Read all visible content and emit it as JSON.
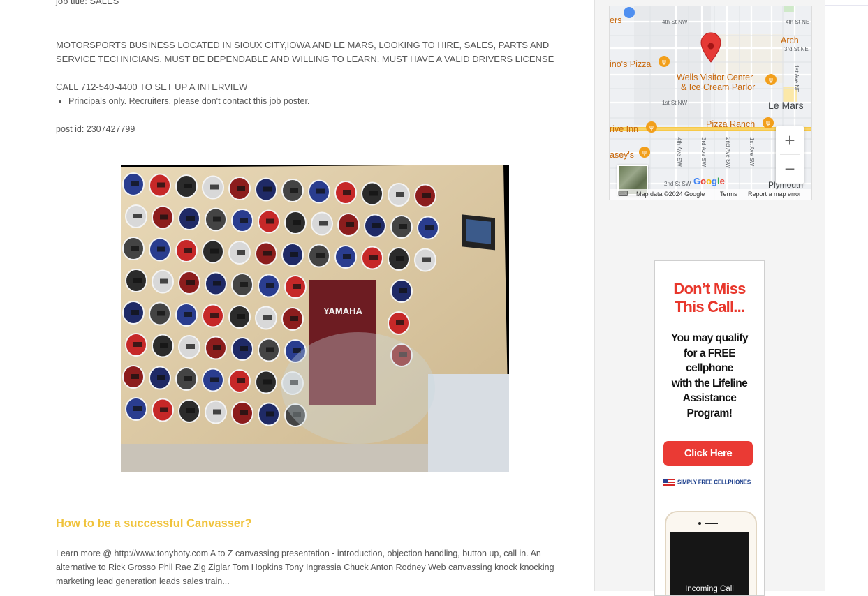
{
  "job": {
    "title_line": "job title: SALES",
    "description": "MOTORSPORTS BUSINESS LOCATED IN SIOUX CITY,IOWA AND LE MARS, LOOKING TO HIRE, SALES, PARTS AND SERVICE TECHNICIANS. MUST BE DEPENDABLE AND WILLING TO LEARN. MUST HAVE A VALID DRIVERS LICENSE",
    "call_line": "CALL 712-540-4400 TO SET UP A INTERVIEW",
    "notice": "Principals only. Recruiters, please don't contact this job poster.",
    "post_id": "post id: 2307427799"
  },
  "photo": {
    "sign_text": "YAMAHA"
  },
  "article": {
    "title": "How to be a successful Canvasser?",
    "text": "Learn more @ http://www.tonyhoty.com A to Z canvassing presentation - introduction, objection handling, button up, call in. An alternative to Rick Grosso Phil Rae Zig Ziglar Tom Hopkins Tony Ingrassia Chuck Anton Rodney Web canvassing knock knocking marketing lead generation leads sales train..."
  },
  "map": {
    "labels": {
      "ers": "ers",
      "st4nw": "4th St NW",
      "st4ne": "4th St NE",
      "arch": "Arch",
      "st3ne": "3rd St NE",
      "pizza": "ino's Pizza",
      "wells1": "Wells Visitor Center",
      "wells2": "& Ice Cream Parlor",
      "ave1ne": "1st Ave NE",
      "st1nw": "1st St NW",
      "lemars": "Le Mars",
      "ranch": "Pizza Ranch",
      "inn": "rive Inn",
      "caseys": "asey's",
      "ave4sw": "4th Ave SW",
      "ave3sw": "3rd Ave SW",
      "ave2sw": "2nd Ave SW",
      "ave1sw": "1st Ave SW",
      "st2sw": "2nd St SW",
      "plymouth": "Plymouth"
    },
    "logo": "Google",
    "zoom_in": "+",
    "zoom_out": "−",
    "footer": {
      "keyboard": "⌨",
      "data": "Map data ©2024 Google",
      "terms": "Terms",
      "report": "Report a map error"
    },
    "colors": {
      "pin": "#e53935",
      "poi": "#f29f1b",
      "highway": "#f7c948"
    }
  },
  "ad": {
    "headline_1": "Don’t Miss",
    "headline_2": "This Call...",
    "body_1": "You may qualify",
    "body_2": "for a FREE",
    "body_3": "cellphone",
    "body_4": "with the Lifeline",
    "body_5": "Assistance",
    "body_6": "Program!",
    "button": "Click Here",
    "brand": "SIMPLY FREE CELLPHONES",
    "phone_text": "Incoming Call",
    "colors": {
      "accent": "#ea3a34",
      "brand": "#1b3e8c"
    }
  }
}
